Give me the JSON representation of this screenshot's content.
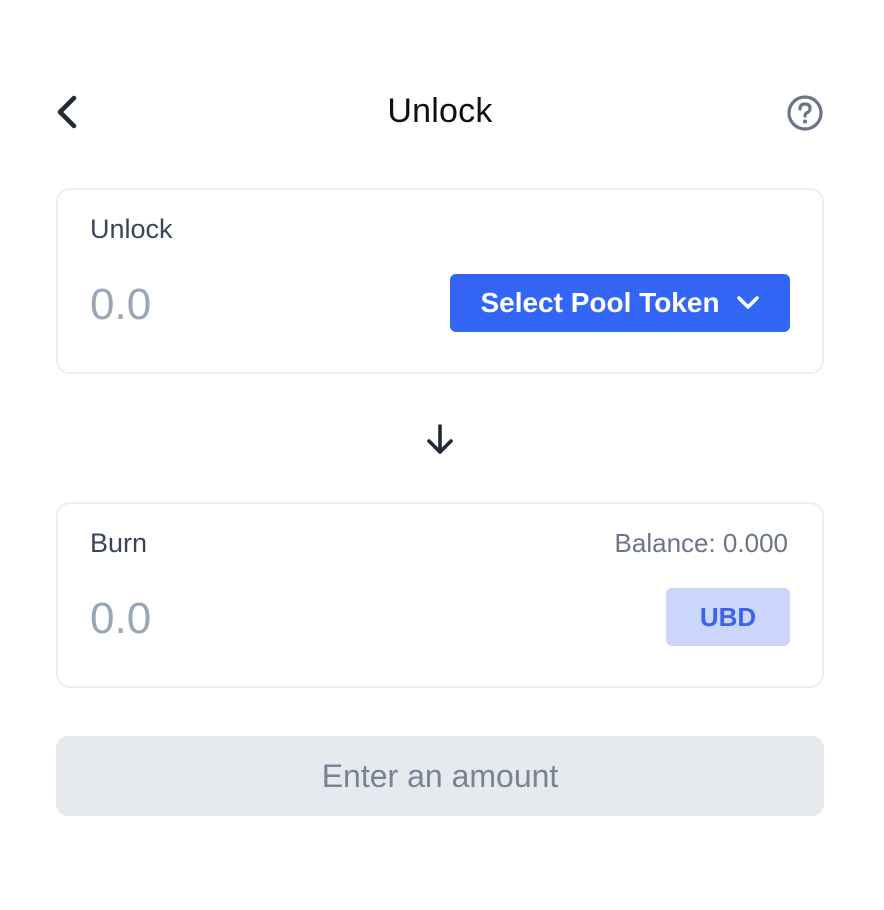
{
  "header": {
    "title": "Unlock",
    "back_icon": "chevron-left-icon",
    "help_icon": "question-circle-icon"
  },
  "unlock_panel": {
    "label": "Unlock",
    "amount_placeholder": "0.0",
    "select_button_label": "Select Pool Token",
    "select_button_icon": "chevron-down-icon",
    "accent_color": "#3366f6"
  },
  "divider": {
    "icon": "arrow-down-icon"
  },
  "burn_panel": {
    "label": "Burn",
    "balance_text": "Balance: 0.000",
    "amount_placeholder": "0.0",
    "token_symbol": "UBD"
  },
  "submit": {
    "label": "Enter an amount",
    "disabled": true
  }
}
